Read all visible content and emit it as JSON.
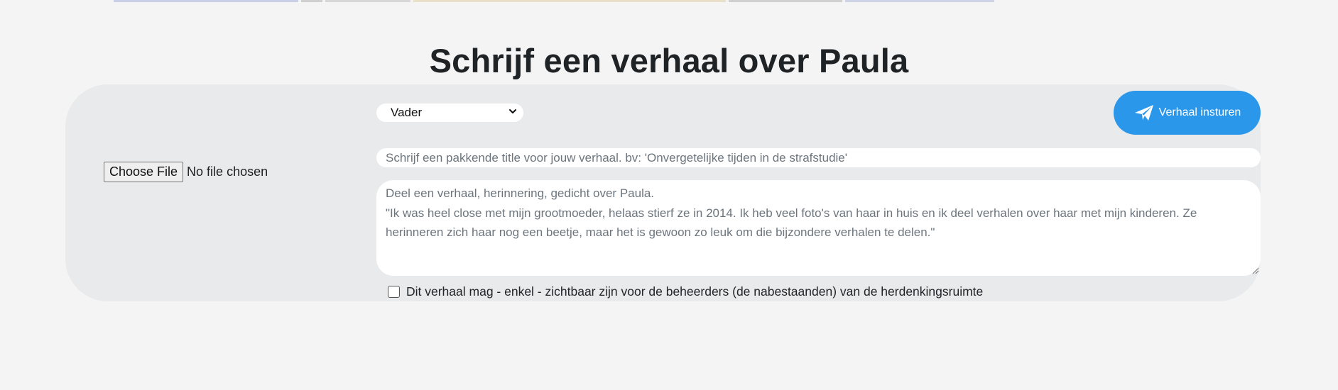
{
  "page": {
    "title": "Schrijf een verhaal over Paula"
  },
  "colors": {
    "accent": "#2b97eb",
    "panel": "#e9eaeb",
    "background": "#f4f4f4"
  },
  "form": {
    "file_button_label": "Choose File",
    "file_status": "No file chosen",
    "relation_select_value": "Vader",
    "submit_label": "Verhaal insturen",
    "submit_icon": "paper-plane-icon",
    "title_placeholder": "Schrijf een pakkende title voor jouw verhaal. bv: 'Onvergetelijke tijden in de strafstudie'",
    "story_placeholder_line1": "Deel een verhaal, herinnering, gedicht over Paula.",
    "story_placeholder_line2": "\"Ik was heel close met mijn grootmoeder, helaas stierf ze in 2014. Ik heb veel foto's van haar in huis en ik deel verhalen over haar met mijn kinderen. Ze herinneren zich haar nog een beetje, maar het is gewoon zo leuk om die bijzondere verhalen te delen.\"",
    "private_checkbox_label": "Dit verhaal mag - enkel - zichtbaar zijn voor de beheerders (de nabestaanden) van de herdenkingsruimte",
    "private_checked": false
  }
}
